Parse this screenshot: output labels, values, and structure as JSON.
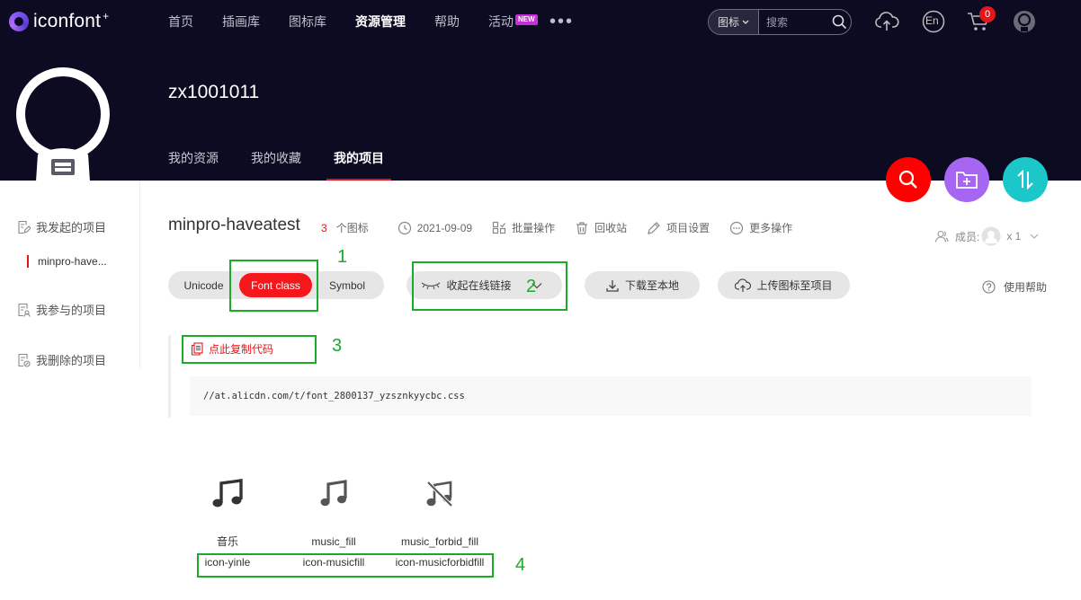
{
  "header": {
    "logo_text": "iconfont",
    "logo_plus": "+",
    "nav": [
      {
        "label": "首页"
      },
      {
        "label": "插画库"
      },
      {
        "label": "图标库"
      },
      {
        "label": "资源管理"
      },
      {
        "label": "帮助"
      },
      {
        "label": "活动",
        "badge": "NEW"
      }
    ],
    "more": "•••",
    "search": {
      "type_label": "图标",
      "placeholder": "搜索"
    },
    "lang_label": "En",
    "cart_count": "0"
  },
  "profile": {
    "username": "zx1001011",
    "tabs": [
      {
        "label": "我的资源"
      },
      {
        "label": "我的收藏"
      },
      {
        "label": "我的项目"
      }
    ]
  },
  "sidebar": {
    "items": [
      {
        "label": "我发起的项目"
      },
      {
        "label": "我参与的项目"
      },
      {
        "label": "我删除的项目"
      }
    ],
    "active_project": "minpro-have..."
  },
  "project": {
    "name": "minpro-haveatest",
    "icon_count": "3",
    "icon_count_label": "个图标",
    "date": "2021-09-09",
    "actions": [
      {
        "label": "批量操作"
      },
      {
        "label": "回收站"
      },
      {
        "label": "项目设置"
      },
      {
        "label": "更多操作"
      }
    ],
    "members_label": "成员:",
    "members_count": "x 1"
  },
  "toolbar": {
    "formats": [
      {
        "label": "Unicode"
      },
      {
        "label": "Font class"
      },
      {
        "label": "Symbol"
      }
    ],
    "collapse_link_label": "收起在线链接",
    "download_label": "下载至本地",
    "upload_label": "上传图标至项目",
    "help_label": "使用帮助"
  },
  "code": {
    "copy_label": "点此复制代码",
    "url": "//at.alicdn.com/t/font_2800137_yzsznkyycbc.css"
  },
  "icons": [
    {
      "name": "音乐",
      "class": "icon-yinle"
    },
    {
      "name": "music_fill",
      "class": "icon-musicfill"
    },
    {
      "name": "music_forbid_fill",
      "class": "icon-musicforbidfill"
    }
  ],
  "annotations": [
    "1",
    "2",
    "3",
    "4"
  ],
  "colors": {
    "header_bg": "#0c0b21",
    "accent_red": "#f5171b",
    "fab_purple": "#a666f2",
    "fab_teal": "#1cc7c9",
    "annotation_green": "#1aab29"
  }
}
